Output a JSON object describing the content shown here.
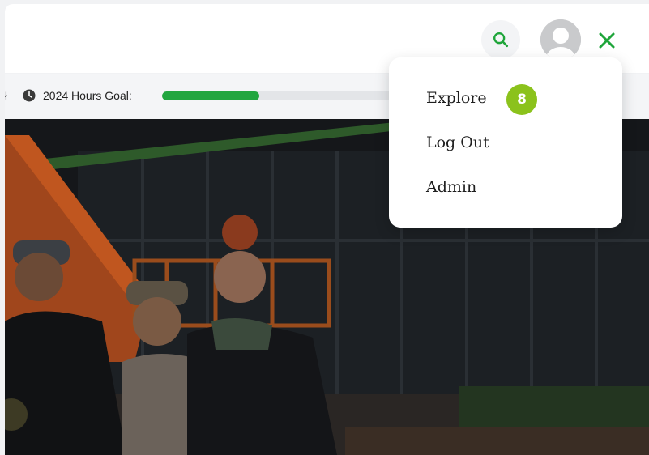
{
  "header": {
    "search_icon": "search-icon",
    "avatar_icon": "user-avatar-icon",
    "close_icon": "close-icon",
    "accent": "#22a63f"
  },
  "goal": {
    "separator": "ł",
    "label": "2024 Hours Goal:",
    "progress_fraction": 0.4,
    "fill_color": "#22a63f"
  },
  "menu": {
    "items": [
      {
        "label": "Explore",
        "badge": "8"
      },
      {
        "label": "Log Out"
      },
      {
        "label": "Admin"
      }
    ],
    "badge_color": "#8bc21c"
  }
}
